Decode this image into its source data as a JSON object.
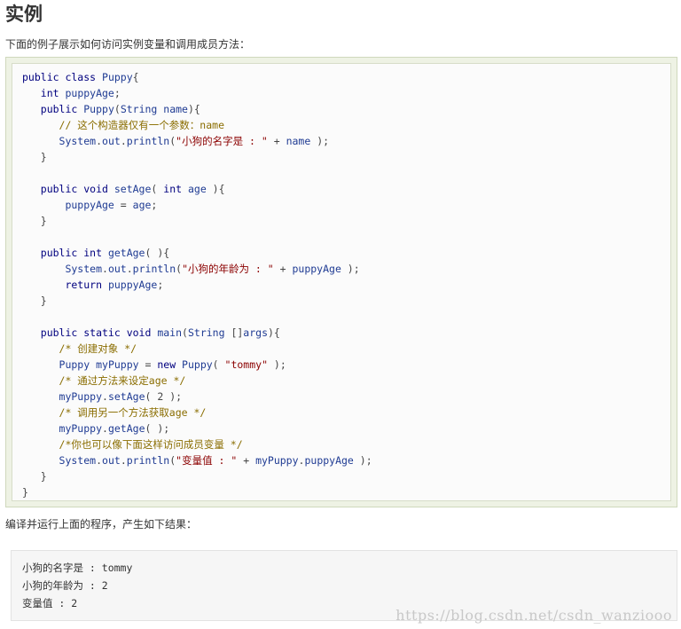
{
  "heading": "实例",
  "intro_text": "下面的例子展示如何访问实例变量和调用成员方法：",
  "code_lines": [
    [
      {
        "t": "public class ",
        "c": "kw"
      },
      {
        "t": "Puppy",
        "c": "id"
      },
      {
        "t": "{",
        "c": "pn"
      }
    ],
    [
      {
        "t": "   int ",
        "c": "kw"
      },
      {
        "t": "puppyAge",
        "c": "id"
      },
      {
        "t": ";",
        "c": "pn"
      }
    ],
    [
      {
        "t": "   public ",
        "c": "kw"
      },
      {
        "t": "Puppy",
        "c": "id"
      },
      {
        "t": "(",
        "c": "pn"
      },
      {
        "t": "String",
        "c": "id"
      },
      {
        "t": " name",
        "c": "id"
      },
      {
        "t": "){",
        "c": "pn"
      }
    ],
    [
      {
        "t": "      // 这个构造器仅有一个参数：name",
        "c": "cm"
      }
    ],
    [
      {
        "t": "      System",
        "c": "id"
      },
      {
        "t": ".",
        "c": "pn"
      },
      {
        "t": "out",
        "c": "id"
      },
      {
        "t": ".",
        "c": "pn"
      },
      {
        "t": "println",
        "c": "id"
      },
      {
        "t": "(",
        "c": "pn"
      },
      {
        "t": "\"小狗的名字是 : \"",
        "c": "st"
      },
      {
        "t": " + ",
        "c": "pn"
      },
      {
        "t": "name",
        "c": "id"
      },
      {
        "t": " );",
        "c": "pn"
      }
    ],
    [
      {
        "t": "   }",
        "c": "pn"
      }
    ],
    [
      {
        "t": "",
        "c": "pn"
      }
    ],
    [
      {
        "t": "   public void ",
        "c": "kw"
      },
      {
        "t": "setAge",
        "c": "id"
      },
      {
        "t": "( ",
        "c": "pn"
      },
      {
        "t": "int ",
        "c": "kw"
      },
      {
        "t": "age",
        "c": "id"
      },
      {
        "t": " ){",
        "c": "pn"
      }
    ],
    [
      {
        "t": "       puppyAge",
        "c": "id"
      },
      {
        "t": " = ",
        "c": "pn"
      },
      {
        "t": "age",
        "c": "id"
      },
      {
        "t": ";",
        "c": "pn"
      }
    ],
    [
      {
        "t": "   }",
        "c": "pn"
      }
    ],
    [
      {
        "t": "",
        "c": "pn"
      }
    ],
    [
      {
        "t": "   public int ",
        "c": "kw"
      },
      {
        "t": "getAge",
        "c": "id"
      },
      {
        "t": "( ){",
        "c": "pn"
      }
    ],
    [
      {
        "t": "       System",
        "c": "id"
      },
      {
        "t": ".",
        "c": "pn"
      },
      {
        "t": "out",
        "c": "id"
      },
      {
        "t": ".",
        "c": "pn"
      },
      {
        "t": "println",
        "c": "id"
      },
      {
        "t": "(",
        "c": "pn"
      },
      {
        "t": "\"小狗的年龄为 : \"",
        "c": "st"
      },
      {
        "t": " + ",
        "c": "pn"
      },
      {
        "t": "puppyAge",
        "c": "id"
      },
      {
        "t": " );",
        "c": "pn"
      }
    ],
    [
      {
        "t": "       return ",
        "c": "kw"
      },
      {
        "t": "puppyAge",
        "c": "id"
      },
      {
        "t": ";",
        "c": "pn"
      }
    ],
    [
      {
        "t": "   }",
        "c": "pn"
      }
    ],
    [
      {
        "t": "",
        "c": "pn"
      }
    ],
    [
      {
        "t": "   public static void ",
        "c": "kw"
      },
      {
        "t": "main",
        "c": "id"
      },
      {
        "t": "(",
        "c": "pn"
      },
      {
        "t": "String",
        "c": "id"
      },
      {
        "t": " []",
        "c": "pn"
      },
      {
        "t": "args",
        "c": "id"
      },
      {
        "t": "){",
        "c": "pn"
      }
    ],
    [
      {
        "t": "      /* 创建对象 */",
        "c": "cm"
      }
    ],
    [
      {
        "t": "      Puppy",
        "c": "id"
      },
      {
        "t": " myPuppy",
        "c": "id"
      },
      {
        "t": " = ",
        "c": "pn"
      },
      {
        "t": "new ",
        "c": "kw"
      },
      {
        "t": "Puppy",
        "c": "id"
      },
      {
        "t": "( ",
        "c": "pn"
      },
      {
        "t": "\"tommy\"",
        "c": "st"
      },
      {
        "t": " );",
        "c": "pn"
      }
    ],
    [
      {
        "t": "      /* 通过方法来设定age */",
        "c": "cm"
      }
    ],
    [
      {
        "t": "      myPuppy",
        "c": "id"
      },
      {
        "t": ".",
        "c": "pn"
      },
      {
        "t": "setAge",
        "c": "id"
      },
      {
        "t": "( 2 );",
        "c": "pn"
      }
    ],
    [
      {
        "t": "      /* 调用另一个方法获取age */",
        "c": "cm"
      }
    ],
    [
      {
        "t": "      myPuppy",
        "c": "id"
      },
      {
        "t": ".",
        "c": "pn"
      },
      {
        "t": "getAge",
        "c": "id"
      },
      {
        "t": "( );",
        "c": "pn"
      }
    ],
    [
      {
        "t": "      /*你也可以像下面这样访问成员变量 */",
        "c": "cm"
      }
    ],
    [
      {
        "t": "      System",
        "c": "id"
      },
      {
        "t": ".",
        "c": "pn"
      },
      {
        "t": "out",
        "c": "id"
      },
      {
        "t": ".",
        "c": "pn"
      },
      {
        "t": "println",
        "c": "id"
      },
      {
        "t": "(",
        "c": "pn"
      },
      {
        "t": "\"变量值 : \"",
        "c": "st"
      },
      {
        "t": " + ",
        "c": "pn"
      },
      {
        "t": "myPuppy",
        "c": "id"
      },
      {
        "t": ".",
        "c": "pn"
      },
      {
        "t": "puppyAge",
        "c": "id"
      },
      {
        "t": " );",
        "c": "pn"
      }
    ],
    [
      {
        "t": "   }",
        "c": "pn"
      }
    ],
    [
      {
        "t": "}",
        "c": "pn"
      }
    ]
  ],
  "after_text": "编译并运行上面的程序，产生如下结果：",
  "output_lines": [
    "小狗的名字是 : tommy",
    "小狗的年龄为 : 2",
    "变量值 : 2"
  ],
  "watermark": "https://blog.csdn.net/csdn_wanziooo"
}
